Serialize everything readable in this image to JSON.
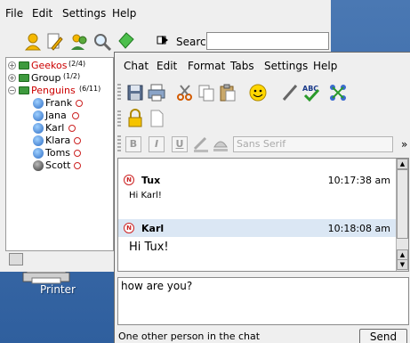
{
  "desktop": {
    "printer_label": "Printer"
  },
  "contact_window": {
    "menu": [
      {
        "label": "File"
      },
      {
        "label": "Edit"
      },
      {
        "label": "Settings"
      },
      {
        "label": "Help"
      }
    ],
    "search_label": "Search:",
    "search_value": "",
    "groups": [
      {
        "name": "Geekos",
        "count": "(2/4)",
        "expanded": false
      },
      {
        "name": "Group",
        "count": "(1/2)",
        "expanded": false
      },
      {
        "name": "Penguins",
        "count": "(6/11)",
        "expanded": true
      }
    ],
    "contacts": [
      {
        "name": "Frank"
      },
      {
        "name": "Jana"
      },
      {
        "name": "Karl"
      },
      {
        "name": "Klara"
      },
      {
        "name": "Toms"
      },
      {
        "name": "Scott"
      }
    ]
  },
  "chat_window": {
    "menu": [
      {
        "label": "Chat"
      },
      {
        "label": "Edit"
      },
      {
        "label": "Format"
      },
      {
        "label": "Tabs"
      },
      {
        "label": "Settings"
      },
      {
        "label": "Help"
      }
    ],
    "font_placeholder": "Sans Serif",
    "messages": [
      {
        "sender": "Tux",
        "time": "10:17:38 am",
        "text": "Hi Karl!"
      },
      {
        "sender": "Karl",
        "time": "10:18:08 am",
        "text": "Hi Tux!"
      }
    ],
    "input_text": "how are you?",
    "status_text": "One other person in the chat",
    "send_label": "Send"
  },
  "colors": {
    "group_name": "#cc0000",
    "status_red": "#cc2222",
    "message_highlight": "#dbe7f4"
  }
}
